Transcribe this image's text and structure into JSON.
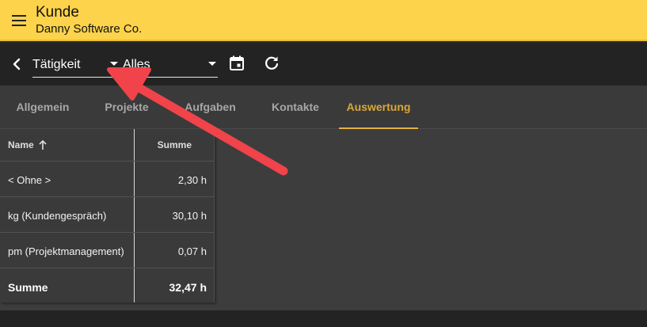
{
  "header": {
    "title": "Kunde",
    "subtitle": "Danny Software Co.",
    "menu_icon": "hamburger-icon",
    "color": "#fcd34a"
  },
  "toolbar": {
    "activity_select": {
      "value": "Tätigkeit"
    },
    "filter_select": {
      "value": "Alles"
    },
    "icons": [
      "back-icon",
      "calendar-icon",
      "refresh-icon"
    ]
  },
  "tabs": [
    {
      "label": "Allgemein",
      "active": false
    },
    {
      "label": "Projekte",
      "active": false
    },
    {
      "label": "Aufgaben",
      "active": false
    },
    {
      "label": "Kontakte",
      "active": false
    },
    {
      "label": "Auswertung",
      "active": true
    }
  ],
  "grid": {
    "columns": [
      "Name",
      "Summe"
    ],
    "sort": "ascending",
    "rows": [
      {
        "name": "< Ohne >",
        "sum": "2,30 h"
      },
      {
        "name": "kg (Kundengespräch)",
        "sum": "30,10 h"
      },
      {
        "name": "pm (Projektmanagement)",
        "sum": "0,07 h"
      }
    ],
    "total": {
      "name": "Summe",
      "sum": "32,47 h"
    }
  },
  "annotation": {
    "color": "#f0434a"
  }
}
